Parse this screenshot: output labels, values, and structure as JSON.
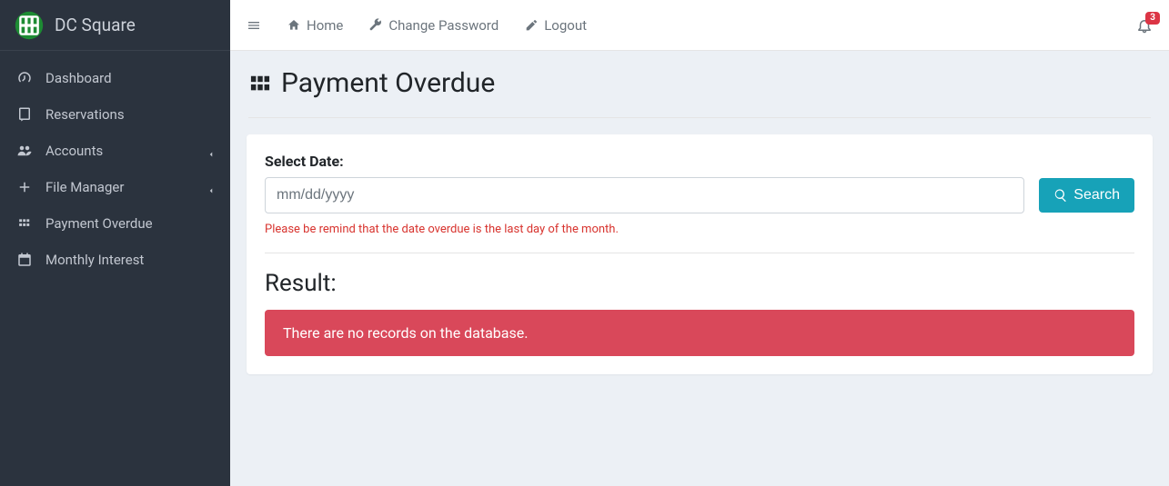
{
  "brand": {
    "title": "DC Square"
  },
  "sidebar": {
    "items": [
      {
        "label": "Dashboard",
        "icon": "tachometer-icon",
        "expandable": false
      },
      {
        "label": "Reservations",
        "icon": "book-icon",
        "expandable": false
      },
      {
        "label": "Accounts",
        "icon": "users-icon",
        "expandable": true
      },
      {
        "label": "File Manager",
        "icon": "plus-icon",
        "expandable": true
      },
      {
        "label": "Payment Overdue",
        "icon": "grid-icon",
        "expandable": false
      },
      {
        "label": "Monthly Interest",
        "icon": "calendar-icon",
        "expandable": false
      }
    ]
  },
  "topbar": {
    "links": [
      {
        "label": "Home",
        "icon": "home-icon"
      },
      {
        "label": "Change Password",
        "icon": "wrench-icon"
      },
      {
        "label": "Logout",
        "icon": "edit-icon"
      }
    ],
    "notifications_count": "3"
  },
  "page": {
    "title": "Payment Overdue"
  },
  "form": {
    "label": "Select Date:",
    "date_placeholder": "mm/dd/yyyy",
    "date_value": "",
    "search_label": "Search",
    "help": "Please be remind that the date overdue is the last day of the month."
  },
  "result": {
    "title": "Result:",
    "alert_text": "There are no records on the database."
  }
}
